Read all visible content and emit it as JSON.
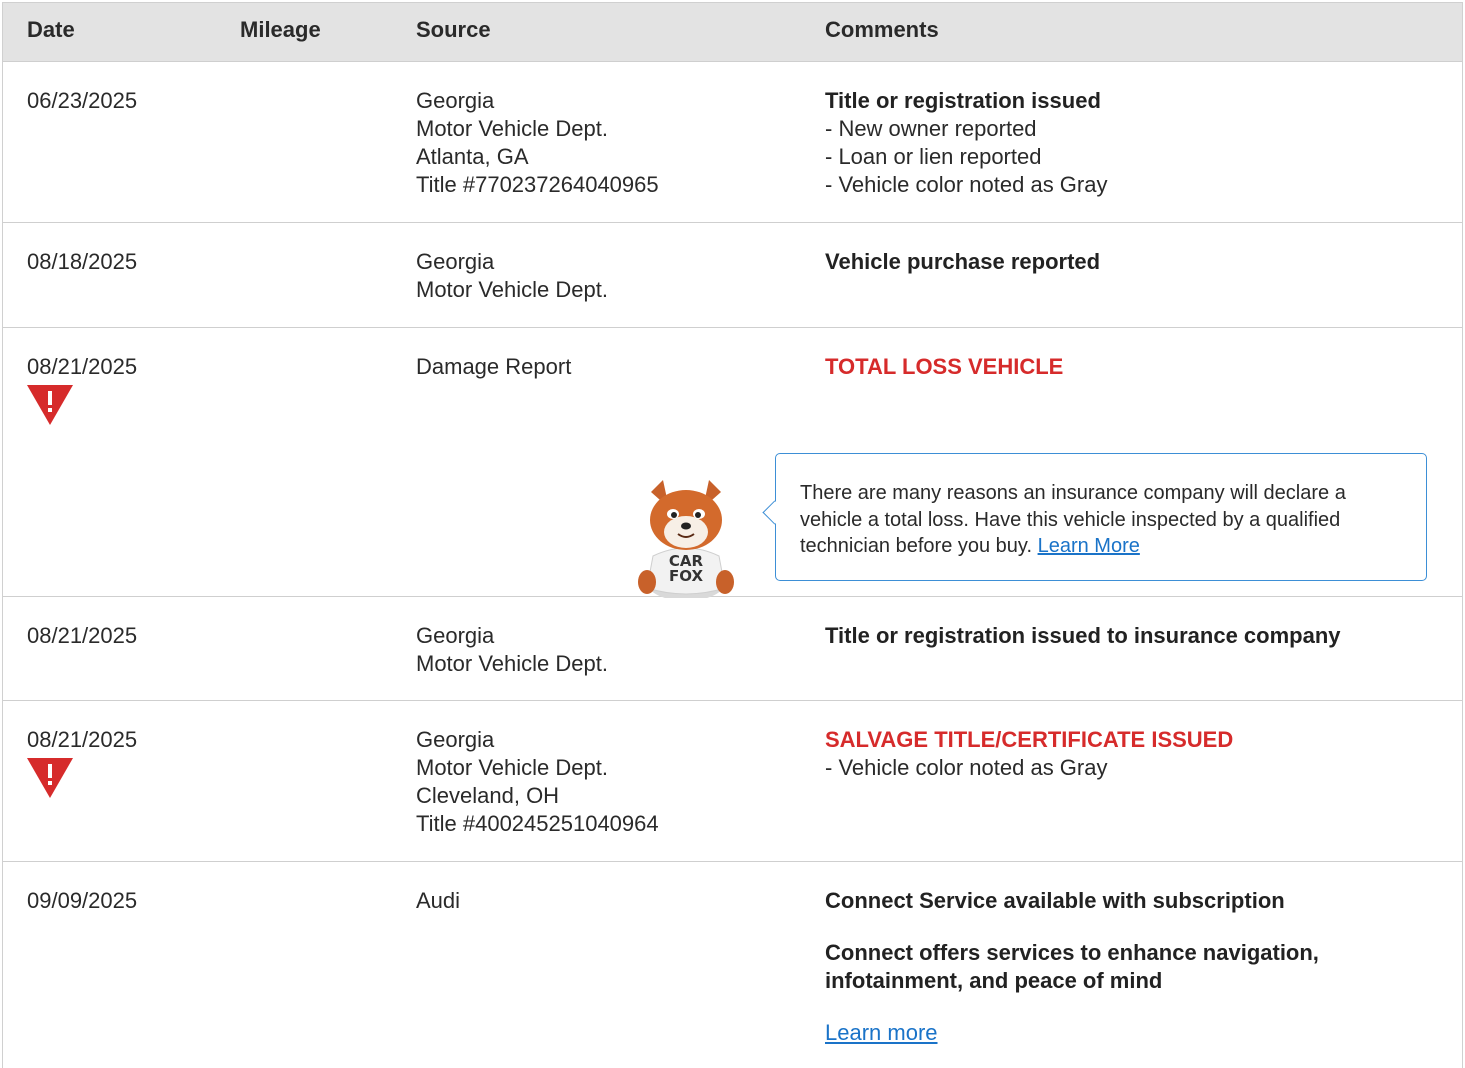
{
  "header": {
    "date": "Date",
    "mileage": "Mileage",
    "source": "Source",
    "comments": "Comments"
  },
  "rows": [
    {
      "date": "06/23/2025",
      "source": [
        "Georgia",
        "Motor Vehicle Dept.",
        "Atlanta, GA",
        "Title #770237264040965"
      ],
      "title": "Title or registration issued",
      "details": [
        "- New owner reported",
        "- Loan or lien reported",
        "- Vehicle color noted as Gray"
      ]
    },
    {
      "date": "08/18/2025",
      "source": [
        "Georgia",
        "Motor Vehicle Dept."
      ],
      "title": "Vehicle purchase reported"
    },
    {
      "date": "08/21/2025",
      "alert_icon": "warning-triangle-icon",
      "source": [
        "Damage Report"
      ],
      "title": "TOTAL LOSS VEHICLE",
      "tip": {
        "text": "There are many reasons an insurance company will declare a vehicle a total loss. Have this vehicle inspected by a qualified technician before you buy.",
        "link": "Learn More",
        "mascot_shirt": [
          "CAR",
          "FOX"
        ]
      }
    },
    {
      "date": "08/21/2025",
      "source": [
        "Georgia",
        "Motor Vehicle Dept."
      ],
      "title": "Title or registration issued to insurance company"
    },
    {
      "date": "08/21/2025",
      "alert_icon": "warning-triangle-icon",
      "source": [
        "Georgia",
        "Motor Vehicle Dept.",
        "Cleveland, OH",
        "Title #400245251040964"
      ],
      "title": "SALVAGE TITLE/CERTIFICATE ISSUED",
      "details": [
        "- Vehicle color noted as Gray"
      ]
    },
    {
      "date": "09/09/2025",
      "source": [
        "Audi"
      ],
      "title": "Connect Service available with subscription",
      "title2": "Connect offers services to enhance navigation, infotainment, and peace of mind",
      "link": "Learn more"
    }
  ],
  "colors": {
    "alert_red": "#d62b2b",
    "link_blue": "#1a73c8",
    "tip_border": "#3d8fd6",
    "header_bg": "#e3e3e3"
  }
}
